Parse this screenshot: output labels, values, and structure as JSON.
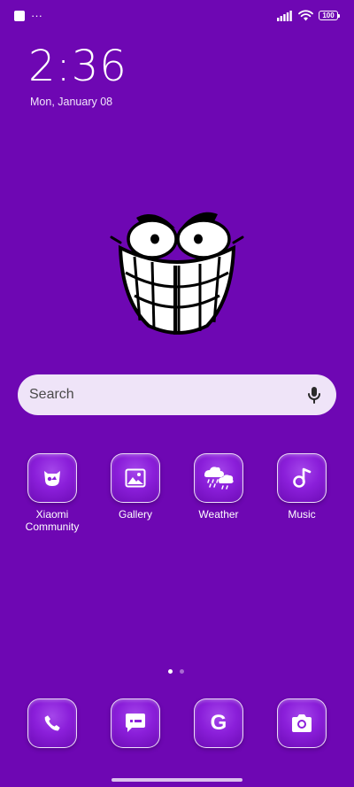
{
  "status_bar": {
    "notification_more": "···",
    "battery_level": "100"
  },
  "lock": {
    "time": "2:36",
    "date": "Mon, January 08"
  },
  "search": {
    "placeholder": "Search"
  },
  "apps": [
    {
      "label": "Xiaomi Community",
      "icon": "mi-bunny-icon"
    },
    {
      "label": "Gallery",
      "icon": "gallery-icon"
    },
    {
      "label": "Weather",
      "icon": "weather-icon"
    },
    {
      "label": "Music",
      "icon": "music-icon"
    }
  ],
  "dock": [
    {
      "icon": "phone-icon"
    },
    {
      "icon": "messages-icon"
    },
    {
      "icon": "google-icon",
      "glyph": "G"
    },
    {
      "icon": "camera-icon"
    }
  ],
  "page_indicator": {
    "pages": 2,
    "current": 1
  },
  "colors": {
    "wallpaper": "#6e07b3",
    "icon_fill": "#8b1fda",
    "search_bg": "#efe4f8"
  }
}
